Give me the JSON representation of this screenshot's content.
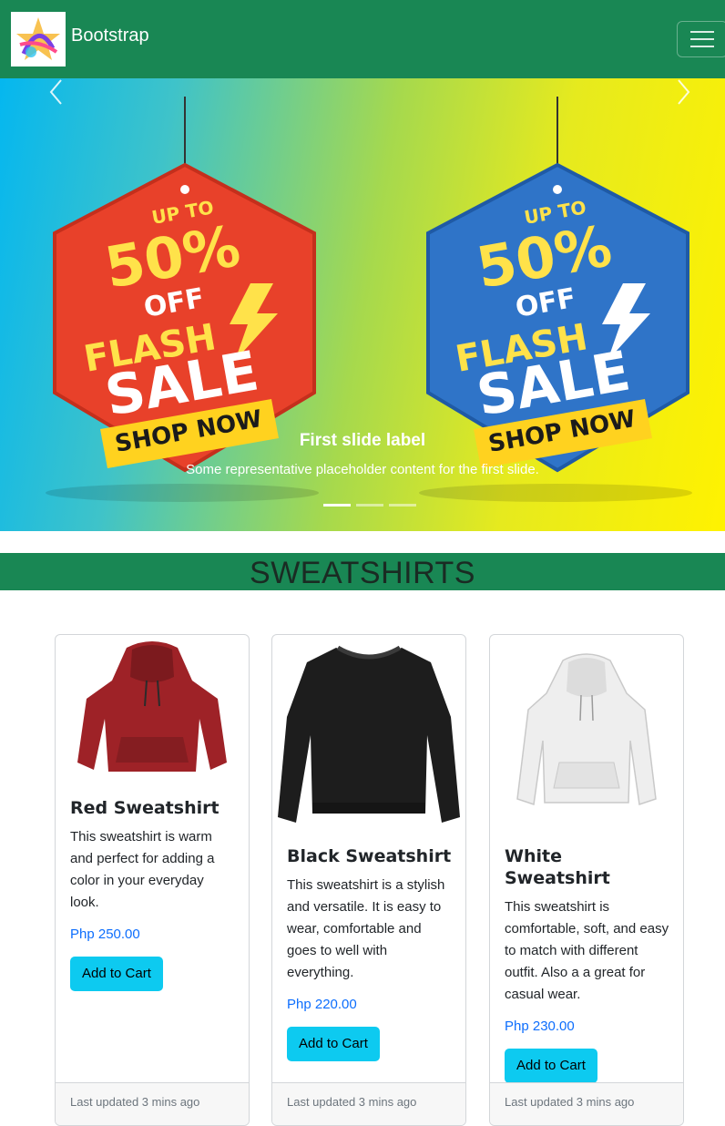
{
  "navbar": {
    "brand": "Bootstrap",
    "colors": {
      "background": "#198754",
      "text": "#ffffff"
    },
    "logo_icon": "star-logo-icon",
    "toggler_icon": "hamburger-icon"
  },
  "carousel": {
    "slides": [
      {
        "title": "First slide label",
        "text": "Some representative placeholder content for the first slide.",
        "banner": {
          "tags": [
            {
              "color": "#e8412a",
              "up_to": "UP TO",
              "percent": "50%",
              "off": "OFF",
              "flash": "FLASH",
              "sale": "SALE",
              "cta": "SHOP NOW"
            },
            {
              "color": "#2f74c8",
              "up_to": "UP TO",
              "percent": "50%",
              "off": "OFF",
              "flash": "FLASH",
              "sale": "SALE",
              "cta": "SHOP NOW"
            }
          ]
        }
      }
    ],
    "indicators": 3,
    "active_indicator": 0,
    "prev_icon": "chevron-left-icon",
    "next_icon": "chevron-right-icon"
  },
  "section": {
    "title": "SWEATSHIRTS",
    "color": "#198754"
  },
  "products": [
    {
      "title": "Red Sweatshirt",
      "text": "This sweatshirt is warm and perfect for adding a color in your everyday look.",
      "price": "Php 250.00",
      "button": "Add to Cart",
      "footer": "Last updated 3 mins ago",
      "color": "#9e2227"
    },
    {
      "title": "Black Sweatshirt",
      "text": "This sweatshirt is a stylish and versatile. It is easy to wear, comfortable and goes to well with everything.",
      "price": "Php 220.00",
      "button": "Add to Cart",
      "footer": "Last updated 3 mins ago",
      "color": "#1d1d1d"
    },
    {
      "title": "White Sweatshirt",
      "text": "This sweatshirt is comfortable, soft, and easy to match with different outfit. Also a a great for casual wear.",
      "price": "Php 230.00",
      "button": "Add to Cart",
      "footer": "Last updated 3 mins ago",
      "color": "#eeeeee"
    }
  ]
}
